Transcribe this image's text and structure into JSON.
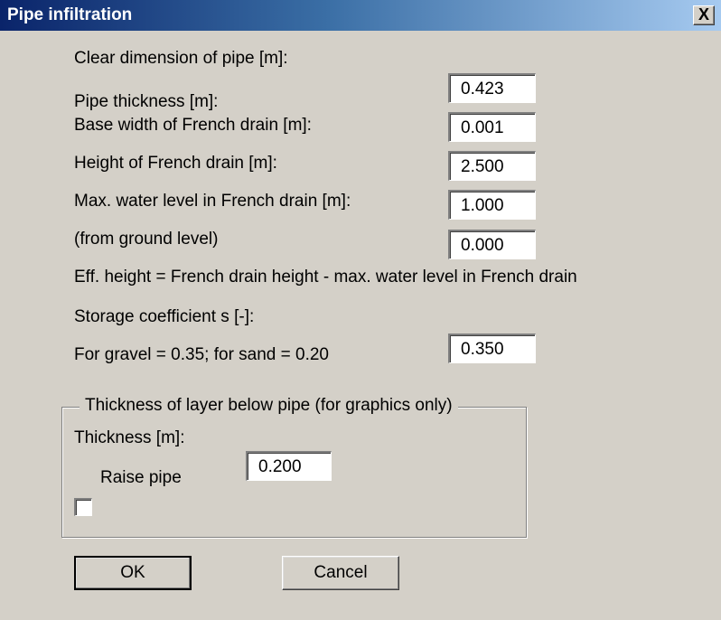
{
  "window": {
    "title": "Pipe infiltration",
    "close_glyph": "X"
  },
  "fields": [
    {
      "label": "Clear dimension of pipe [m]:",
      "value": "0.423"
    },
    {
      "label": "Pipe thickness [m]:",
      "value": "0.001"
    },
    {
      "label": "Base width of French drain [m]:",
      "value": "2.500"
    },
    {
      "label": "Height of French drain [m]:",
      "value": "1.000"
    },
    {
      "label": "Max. water level in French drain [m]:",
      "value": "0.000"
    }
  ],
  "notes": {
    "ground_level": "(from ground level)",
    "eff_height": "Eff. height = French drain height - max. water level in French drain",
    "gravel_sand": "For gravel = 0.35; for sand = 0.20"
  },
  "storage": {
    "label": "Storage coefficient s [-]:",
    "value": "0.350"
  },
  "group": {
    "legend": "Thickness of layer below pipe (for graphics only)",
    "thickness_label": "Thickness [m]:",
    "thickness_value": "0.200",
    "raise_label": "Raise pipe",
    "raise_checked": false
  },
  "buttons": {
    "ok": "OK",
    "cancel": "Cancel"
  }
}
